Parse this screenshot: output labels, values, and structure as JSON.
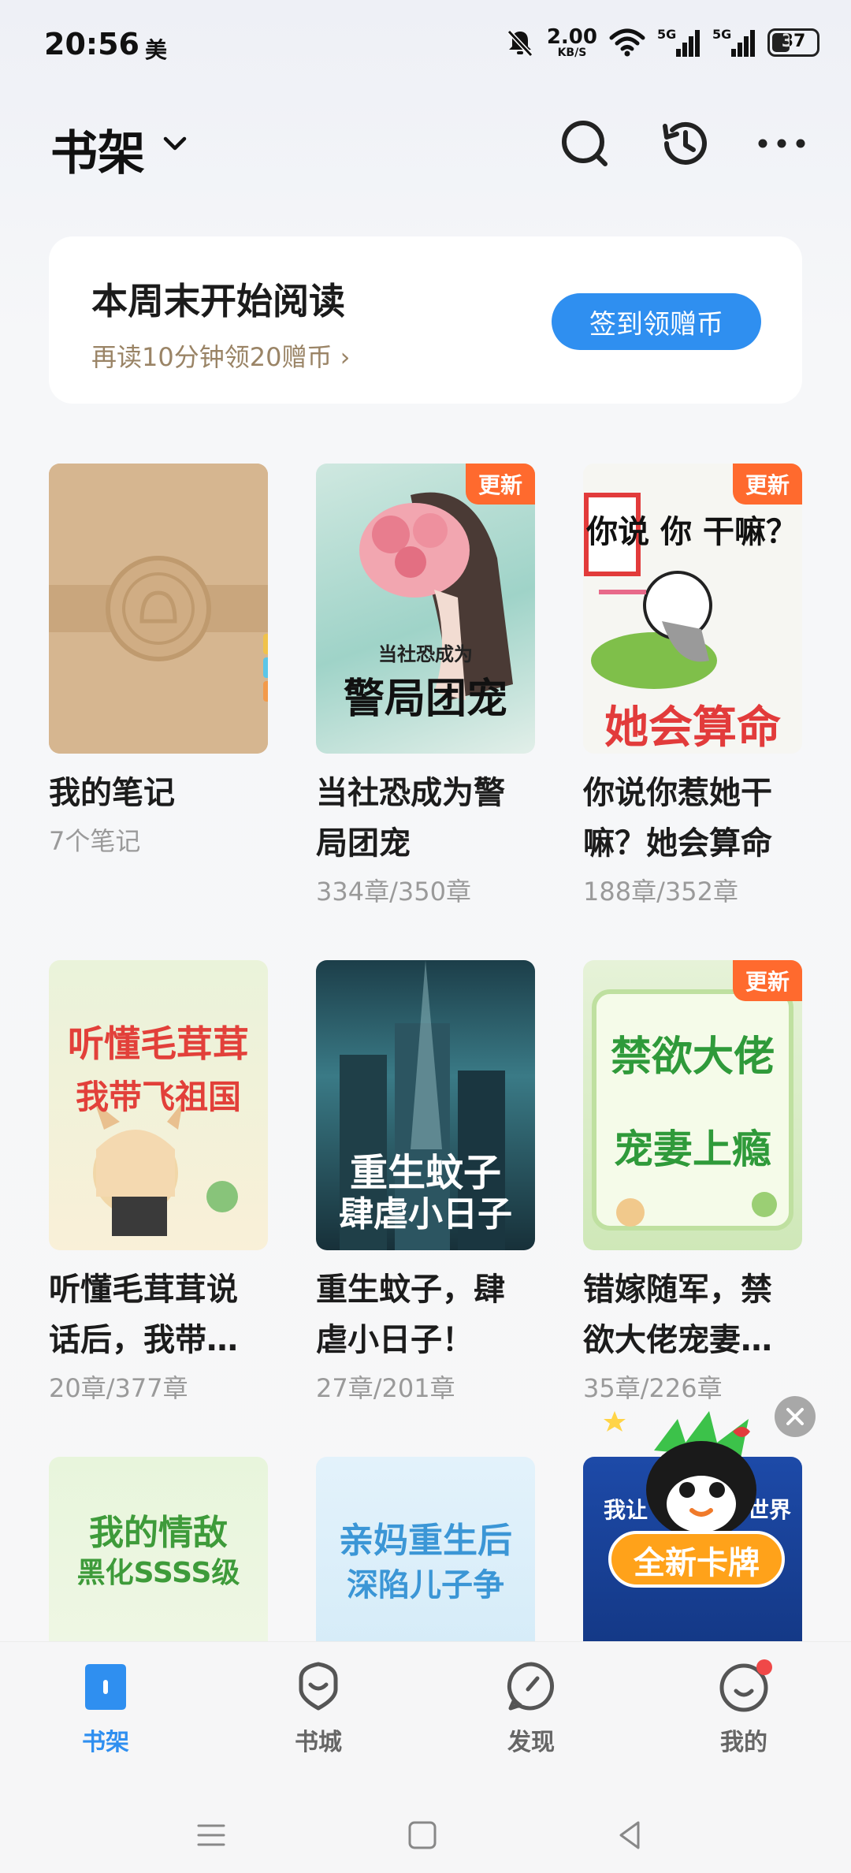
{
  "status_bar": {
    "time": "20:56",
    "carrier": "美",
    "net_speed_value": "2.00",
    "net_speed_unit": "KB/S",
    "signal1_label": "5G",
    "signal2_label": "5G",
    "battery": "37"
  },
  "header": {
    "title": "书架"
  },
  "checkin": {
    "title": "本周末开始阅读",
    "subtitle": "再读10分钟领20赠币 ›",
    "button": "签到领赠币"
  },
  "books": [
    {
      "title": "我的笔记",
      "progress": "7个笔记",
      "badge": ""
    },
    {
      "title": "当社恐成为警局团宠",
      "progress": "334章/350章",
      "badge": "更新",
      "cover_title": "警局团宠",
      "cover_sub": "当社恐成为"
    },
    {
      "title": "你说你惹她干嘛？她会算命",
      "progress": "188章/352章",
      "badge": "更新",
      "cover_title": "她会算命",
      "cover_top": "你说 你 干嘛？"
    },
    {
      "title": "听懂毛茸茸说话后，我带飞祖国",
      "progress": "20章/377章",
      "badge": "",
      "cover_title": "听懂毛茸茸",
      "cover_sub": "我带飞祖国"
    },
    {
      "title": "重生蚊子，肆虐小日子！",
      "progress": "27章/201章",
      "badge": "",
      "cover_title": "重生蚊子",
      "cover_sub": "肆虐小日子"
    },
    {
      "title": "错嫁随军，禁欲大佬宠妻上瘾",
      "progress": "35章/226章",
      "badge": "更新",
      "cover_title": "禁欲大佬",
      "cover_sub": "宠妻上瘾"
    },
    {
      "title": "",
      "progress": "",
      "badge": "",
      "cover_title": "我的情敌",
      "cover_sub": "黑化SSSS级"
    },
    {
      "title": "",
      "progress": "",
      "badge": "",
      "cover_title": "亲妈重生后",
      "cover_sub": "深陷儿子争"
    },
    {
      "title": "",
      "progress": "",
      "badge": "",
      "cover_title": "我让",
      "cover_sub": "世界"
    }
  ],
  "promo": {
    "label": "全新卡牌"
  },
  "bottom_nav": [
    {
      "label": "书架",
      "icon": "bookshelf-icon",
      "active": true
    },
    {
      "label": "书城",
      "icon": "bookstore-icon",
      "active": false
    },
    {
      "label": "发现",
      "icon": "compass-icon",
      "active": false
    },
    {
      "label": "我的",
      "icon": "profile-icon",
      "active": false
    }
  ],
  "colors": {
    "accent": "#2f8ff0",
    "badge": "#ff6a2e",
    "subtitle": "#9a8466"
  }
}
